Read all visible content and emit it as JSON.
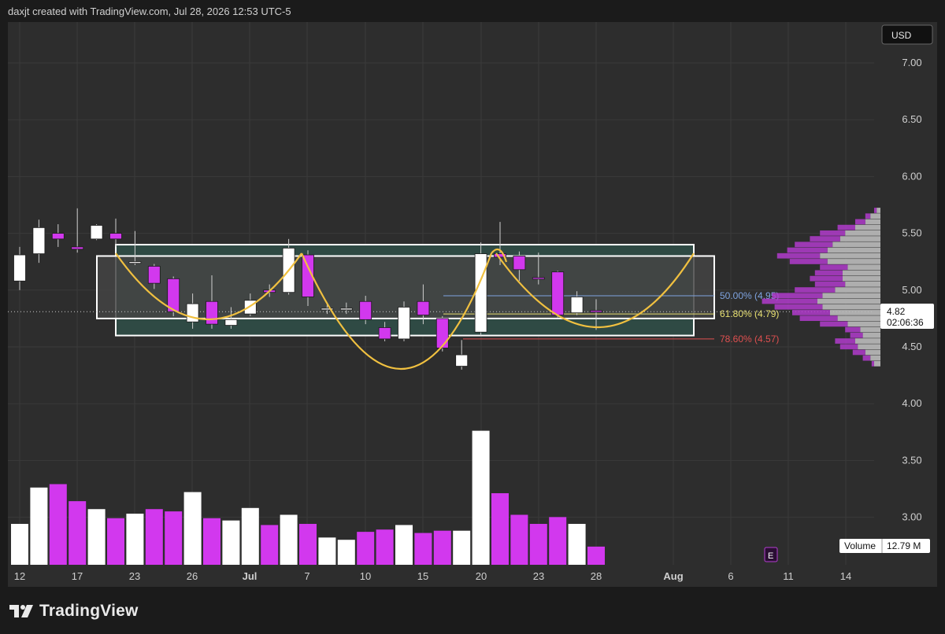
{
  "header": {
    "credit": "daxjt created with TradingView.com, Jul 28, 2026 12:53 UTC-5"
  },
  "footer": {
    "brand": "TradingView",
    "brand_icon": "tradingview-logo-icon"
  },
  "colors": {
    "background": "#2d2d2d",
    "up_candle": "#ffffff",
    "down_candle": "#d238ee",
    "pattern_curve": "#f0c040",
    "box_fill": "#2f4a44",
    "fib_50": "#7fa4e0",
    "fib_618": "#e8e070",
    "fib_786": "#e05050"
  },
  "chart_data": {
    "type": "candlestick",
    "currency_label": "USD",
    "y_ticks": [
      "7.00",
      "6.50",
      "6.00",
      "5.50",
      "5.00",
      "4.50",
      "4.00",
      "3.50",
      "3.00"
    ],
    "x_ticks": [
      "12",
      "17",
      "23",
      "26",
      "Jul",
      "7",
      "10",
      "15",
      "20",
      "23",
      "28",
      "Aug",
      "6",
      "11",
      "14"
    ],
    "last_price": "4.82",
    "countdown": "02:06:36",
    "volume_label": "Volume",
    "volume_value": "12.79 M",
    "earnings_marker": "E",
    "fib_levels": [
      {
        "label": "50.00% (4.95)",
        "value": 4.95
      },
      {
        "label": "61.80% (4.79)",
        "value": 4.79
      },
      {
        "label": "78.60% (4.57)",
        "value": 4.57
      }
    ],
    "candles": [
      {
        "open": 5.08,
        "high": 5.38,
        "low": 5.0,
        "close": 5.31
      },
      {
        "open": 5.32,
        "high": 5.62,
        "low": 5.24,
        "close": 5.55
      },
      {
        "open": 5.5,
        "high": 5.58,
        "low": 5.38,
        "close": 5.45
      },
      {
        "open": 5.38,
        "high": 5.72,
        "low": 5.33,
        "close": 5.36
      },
      {
        "open": 5.45,
        "high": 5.58,
        "low": 5.44,
        "close": 5.57
      },
      {
        "open": 5.5,
        "high": 5.63,
        "low": 5.38,
        "close": 5.45
      },
      {
        "open": 5.24,
        "high": 5.52,
        "low": 5.22,
        "close": 5.25
      },
      {
        "open": 5.21,
        "high": 5.23,
        "low": 5.01,
        "close": 5.06
      },
      {
        "open": 5.1,
        "high": 5.12,
        "low": 4.77,
        "close": 4.81
      },
      {
        "open": 4.72,
        "high": 4.97,
        "low": 4.66,
        "close": 4.88
      },
      {
        "open": 4.9,
        "high": 5.13,
        "low": 4.66,
        "close": 4.7
      },
      {
        "open": 4.69,
        "high": 4.85,
        "low": 4.66,
        "close": 4.74
      },
      {
        "open": 4.79,
        "high": 4.97,
        "low": 4.77,
        "close": 4.91
      },
      {
        "open": 5.0,
        "high": 5.05,
        "low": 4.94,
        "close": 4.98
      },
      {
        "open": 4.98,
        "high": 5.45,
        "low": 4.96,
        "close": 5.37
      },
      {
        "open": 5.31,
        "high": 5.35,
        "low": 4.86,
        "close": 4.94
      },
      {
        "open": 4.83,
        "high": 4.89,
        "low": 4.79,
        "close": 4.84
      },
      {
        "open": 4.83,
        "high": 4.89,
        "low": 4.79,
        "close": 4.84
      },
      {
        "open": 4.9,
        "high": 4.95,
        "low": 4.7,
        "close": 4.74
      },
      {
        "open": 4.67,
        "high": 4.72,
        "low": 4.55,
        "close": 4.57
      },
      {
        "open": 4.57,
        "high": 4.9,
        "low": 4.55,
        "close": 4.85
      },
      {
        "open": 4.9,
        "high": 5.05,
        "low": 4.7,
        "close": 4.78
      },
      {
        "open": 4.75,
        "high": 4.77,
        "low": 4.46,
        "close": 4.49
      },
      {
        "open": 4.33,
        "high": 4.56,
        "low": 4.3,
        "close": 4.43
      },
      {
        "open": 4.63,
        "high": 5.42,
        "low": 4.6,
        "close": 5.32
      },
      {
        "open": 5.32,
        "high": 5.6,
        "low": 5.22,
        "close": 5.29
      },
      {
        "open": 5.3,
        "high": 5.34,
        "low": 5.08,
        "close": 5.18
      },
      {
        "open": 5.11,
        "high": 5.33,
        "low": 5.05,
        "close": 5.1
      },
      {
        "open": 5.16,
        "high": 5.17,
        "low": 4.76,
        "close": 4.78
      },
      {
        "open": 4.8,
        "high": 4.99,
        "low": 4.78,
        "close": 4.94
      },
      {
        "open": 4.82,
        "high": 4.92,
        "low": 4.65,
        "close": 4.81
      }
    ],
    "volumes": [
      2.96,
      3.28,
      3.31,
      3.16,
      3.09,
      3.01,
      3.05,
      3.09,
      3.07,
      3.24,
      3.01,
      2.99,
      3.1,
      2.95,
      3.04,
      2.96,
      2.84,
      2.82,
      2.89,
      2.91,
      2.95,
      2.88,
      2.9,
      2.9,
      3.78,
      3.23,
      3.04,
      2.96,
      3.02,
      2.96,
      2.76
    ],
    "volume_profile": [
      {
        "price": 4.35,
        "up": 0.05,
        "down": 0.02
      },
      {
        "price": 4.4,
        "up": 0.08,
        "down": 0.06
      },
      {
        "price": 4.45,
        "up": 0.12,
        "down": 0.1
      },
      {
        "price": 4.5,
        "up": 0.18,
        "down": 0.14
      },
      {
        "price": 4.55,
        "up": 0.2,
        "down": 0.16
      },
      {
        "price": 4.6,
        "up": 0.14,
        "down": 0.1
      },
      {
        "price": 4.65,
        "up": 0.16,
        "down": 0.12
      },
      {
        "price": 4.7,
        "up": 0.26,
        "down": 0.22
      },
      {
        "price": 4.75,
        "up": 0.34,
        "down": 0.3
      },
      {
        "price": 4.8,
        "up": 0.4,
        "down": 0.3
      },
      {
        "price": 4.85,
        "up": 0.46,
        "down": 0.38
      },
      {
        "price": 4.9,
        "up": 0.5,
        "down": 0.44
      },
      {
        "price": 4.95,
        "up": 0.46,
        "down": 0.4
      },
      {
        "price": 5.0,
        "up": 0.36,
        "down": 0.32
      },
      {
        "price": 5.05,
        "up": 0.28,
        "down": 0.24
      },
      {
        "price": 5.1,
        "up": 0.3,
        "down": 0.26
      },
      {
        "price": 5.15,
        "up": 0.3,
        "down": 0.22
      },
      {
        "price": 5.2,
        "up": 0.26,
        "down": 0.22
      },
      {
        "price": 5.25,
        "up": 0.42,
        "down": 0.3
      },
      {
        "price": 5.3,
        "up": 0.48,
        "down": 0.34
      },
      {
        "price": 5.35,
        "up": 0.42,
        "down": 0.32
      },
      {
        "price": 5.4,
        "up": 0.38,
        "down": 0.3
      },
      {
        "price": 5.45,
        "up": 0.32,
        "down": 0.24
      },
      {
        "price": 5.5,
        "up": 0.28,
        "down": 0.2
      },
      {
        "price": 5.55,
        "up": 0.2,
        "down": 0.14
      },
      {
        "price": 5.6,
        "up": 0.12,
        "down": 0.08
      },
      {
        "price": 5.65,
        "up": 0.08,
        "down": 0.04
      },
      {
        "price": 5.7,
        "up": 0.03,
        "down": 0.02
      }
    ]
  }
}
